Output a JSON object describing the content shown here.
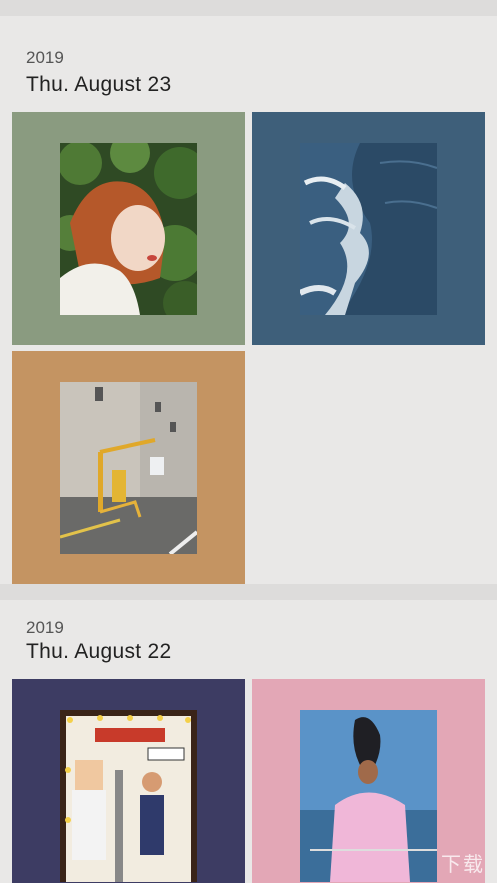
{
  "sections": [
    {
      "year": "2019",
      "date": "Thu. August 23",
      "photos": [
        {
          "frame_color": "#8a9b80",
          "subject": "red-haired woman among leaves"
        },
        {
          "frame_color": "#3e5f7a",
          "subject": "ocean waves"
        },
        {
          "frame_color": "#c49462",
          "subject": "parking lot gate and building"
        }
      ]
    },
    {
      "year": "2019",
      "date": "Thu. August 22",
      "photos": [
        {
          "frame_color": "#3d3c63",
          "subject": "street poster with statue and woman"
        },
        {
          "frame_color": "#e3a7b6",
          "subject": "person in pink shirt at sea"
        }
      ]
    }
  ],
  "watermark": "下载"
}
